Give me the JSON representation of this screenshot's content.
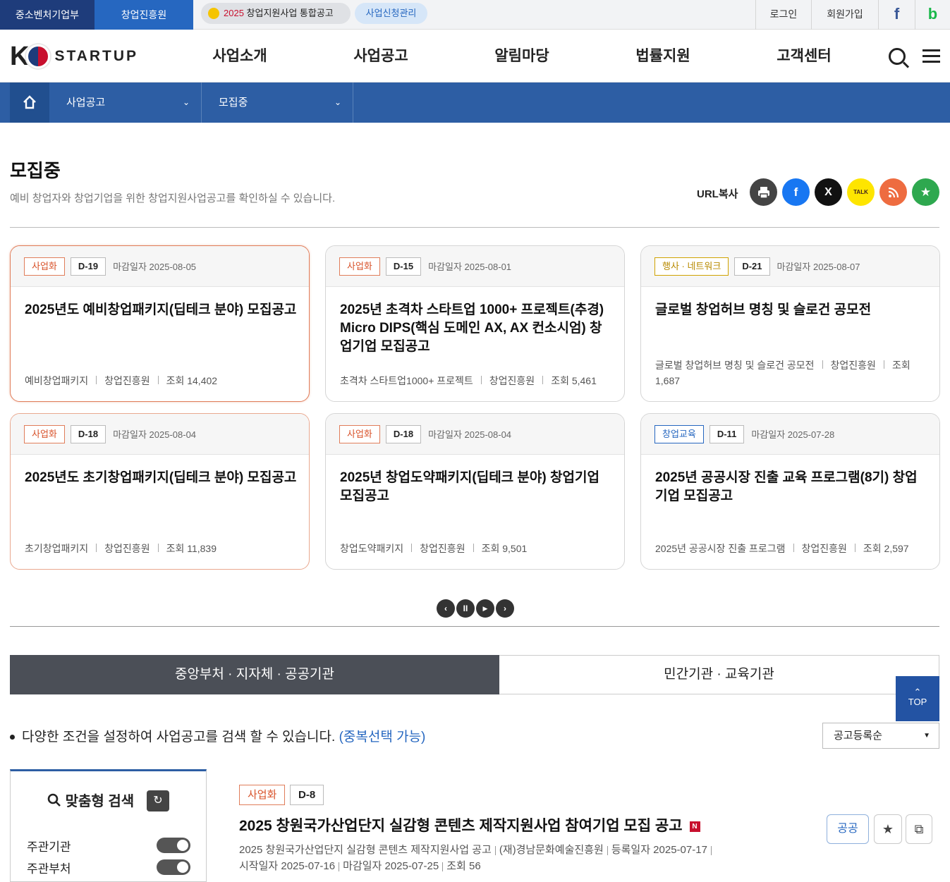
{
  "topbar": {
    "ministry": "중소벤처기업부",
    "agency": "창업진흥원",
    "integrated_year": "2025",
    "integrated_label": "창업지원사업 통합공고",
    "apply_mgmt": "사업신청관리",
    "login": "로그인",
    "join": "회원가입",
    "facebook": "f",
    "blog": "b"
  },
  "header": {
    "logo_k": "K",
    "logo_text": "STARTUP",
    "nav": [
      "사업소개",
      "사업공고",
      "알림마당",
      "법률지원",
      "고객센터"
    ]
  },
  "locbar": {
    "home_icon": "home-icon",
    "dd1": "사업공고",
    "dd2": "모집중"
  },
  "page": {
    "title": "모집중",
    "desc": "예비 창업자와 창업기업을 위한 창업지원사업공고를 확인하실 수 있습니다.",
    "url_copy": "URL복사",
    "share": {
      "print": "print-icon",
      "facebook": "f",
      "x": "X",
      "kakao": "TALK",
      "rss": "rss-icon",
      "favorite": "★"
    }
  },
  "cards": [
    {
      "tag": "사업화",
      "dday": "D-19",
      "deadline": "마감일자 2025-08-05",
      "title": "2025년도 예비창업패키지(딥테크 분야) 모집공고",
      "meta": [
        "예비창업패키지",
        "창업진흥원",
        "조회 14,402"
      ]
    },
    {
      "tag": "사업화",
      "dday": "D-15",
      "deadline": "마감일자 2025-08-01",
      "title": "2025년 초격차 스타트업 1000+ 프로젝트(추경) Micro DIPS(핵심 도메인 AX, AX 컨소시엄) 창업기업 모집공고",
      "meta": [
        "초격차 스타트업1000+ 프로젝트",
        "창업진흥원",
        "조회 5,461"
      ]
    },
    {
      "tag": "행사 · 네트워크",
      "dday": "D-21",
      "deadline": "마감일자 2025-08-07",
      "title": "글로벌 창업허브 명칭 및 슬로건 공모전",
      "meta": [
        "글로벌 창업허브 명칭 및 슬로건 공모전",
        "창업진흥원",
        "조회 1,687"
      ]
    },
    {
      "tag": "사업화",
      "dday": "D-18",
      "deadline": "마감일자 2025-08-04",
      "title": "2025년도 초기창업패키지(딥테크 분야) 모집공고",
      "meta": [
        "초기창업패키지",
        "창업진흥원",
        "조회 11,839"
      ]
    },
    {
      "tag": "사업화",
      "dday": "D-18",
      "deadline": "마감일자 2025-08-04",
      "title": "2025년 창업도약패키지(딥테크 분야) 창업기업 모집공고",
      "meta": [
        "창업도약패키지",
        "창업진흥원",
        "조회 9,501"
      ]
    },
    {
      "tag": "창업교육",
      "dday": "D-11",
      "deadline": "마감일자 2025-07-28",
      "title": "2025년 공공시장 진출 교육 프로그램(8기) 창업기업 모집공고",
      "meta": [
        "2025년 공공시장 진출 프로그램",
        "창업진흥원",
        "조회 2,597"
      ]
    }
  ],
  "slider": {
    "prev": "‹",
    "pause": "II",
    "play": "▶",
    "next": "›"
  },
  "tabs": {
    "tab1": "중앙부처 · 지자체 · 공공기관",
    "tab2": "민간기관 · 교육기관"
  },
  "top_button": {
    "arrow": "⌃",
    "label": "TOP"
  },
  "filter": {
    "info": "다양한 조건을 설정하여 사업공고를 검색 할 수 있습니다.",
    "info_note": "(중복선택 가능)",
    "sort": "공고등록순",
    "panel_title": "맞춤형 검색",
    "reset_icon": "↻",
    "rows": [
      "주관기관",
      "주관부처"
    ]
  },
  "list_item": {
    "tag": "사업화",
    "dday": "D-8",
    "title": "2025 창원국가산업단지 실감형 콘텐츠 제작지원사업 참여기업 모집 공고",
    "new_badge": "N",
    "meta1": [
      "2025 창원국가산업단지 실감형 콘텐츠 제작지원사업 공고",
      "(재)경남문화예술진흥원",
      "등록일자 2025-07-17"
    ],
    "meta2": [
      "시작일자 2025-07-16",
      "마감일자 2025-07-25",
      "조회 56"
    ],
    "share_btn": "공공",
    "fav": "★",
    "copy": "⧉"
  },
  "colors": {
    "navy": "#1e3c7b",
    "blue": "#2667c0",
    "locbar": "#2d5ea4",
    "accent": "#e07d5a"
  }
}
